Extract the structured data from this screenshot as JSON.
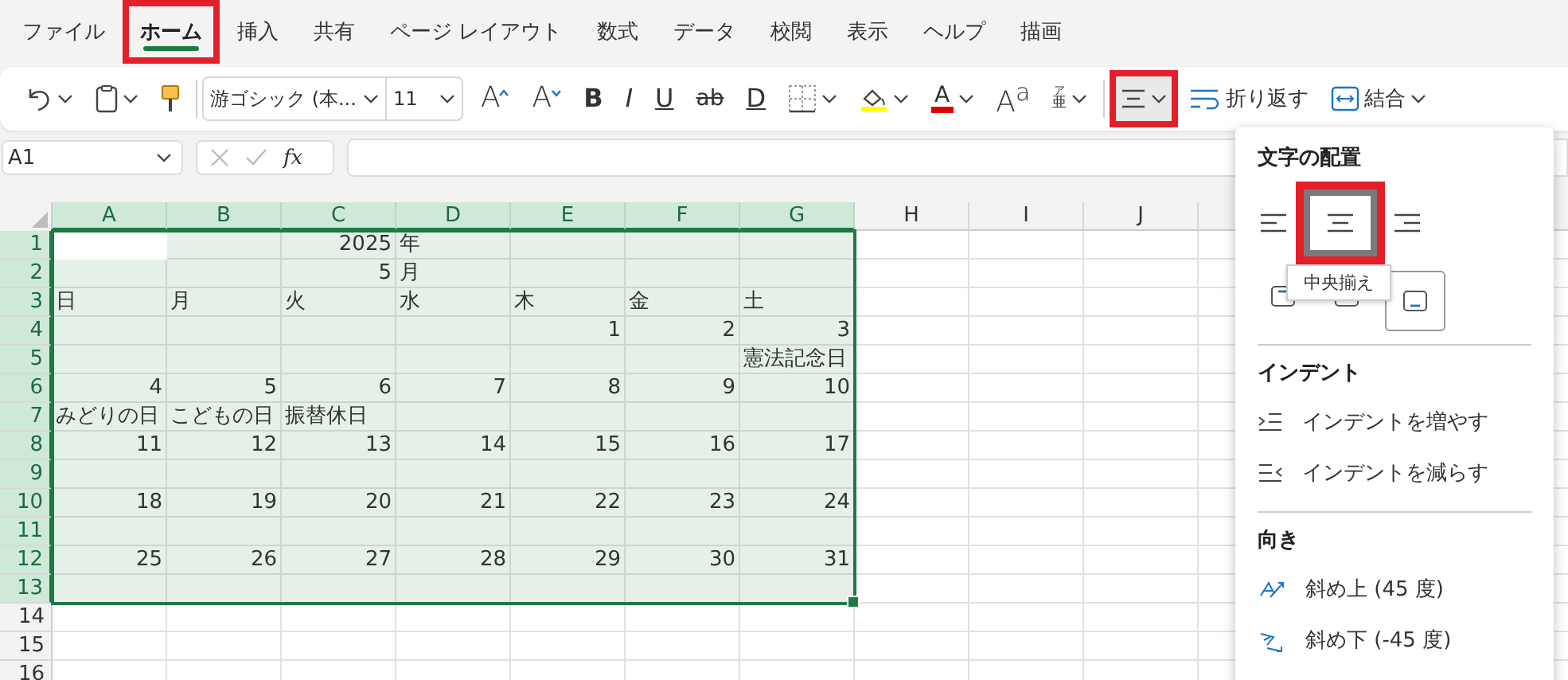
{
  "ribbon_tabs": [
    {
      "label": "ファイル",
      "selected": false,
      "highlighted": false
    },
    {
      "label": "ホーム",
      "selected": true,
      "highlighted": true
    },
    {
      "label": "挿入",
      "selected": false,
      "highlighted": false
    },
    {
      "label": "共有",
      "selected": false,
      "highlighted": false
    },
    {
      "label": "ページ レイアウト",
      "selected": false,
      "highlighted": false
    },
    {
      "label": "数式",
      "selected": false,
      "highlighted": false
    },
    {
      "label": "データ",
      "selected": false,
      "highlighted": false
    },
    {
      "label": "校閲",
      "selected": false,
      "highlighted": false
    },
    {
      "label": "表示",
      "selected": false,
      "highlighted": false
    },
    {
      "label": "ヘルプ",
      "selected": false,
      "highlighted": false
    },
    {
      "label": "描画",
      "selected": false,
      "highlighted": false
    }
  ],
  "toolbar": [
    {
      "kind": "undo",
      "caret": true
    },
    {
      "kind": "paste",
      "caret": true
    },
    {
      "kind": "format-painter",
      "caret": false
    },
    {
      "kind": "separator"
    },
    {
      "kind": "font",
      "value": "游ゴシック (本...",
      "caret": true
    },
    {
      "kind": "size",
      "value": "11",
      "caret": true
    },
    {
      "kind": "grow",
      "text": "A",
      "caret": false
    },
    {
      "kind": "shrink",
      "text": "A",
      "caret": false
    },
    {
      "kind": "bold",
      "text": "B",
      "caret": false
    },
    {
      "kind": "italic",
      "text": "I",
      "caret": false
    },
    {
      "kind": "underline",
      "text": "U",
      "caret": false
    },
    {
      "kind": "strike",
      "text": "ab",
      "caret": false
    },
    {
      "kind": "double-underline",
      "text": "D",
      "caret": false
    },
    {
      "kind": "borders",
      "caret": true
    },
    {
      "kind": "fill-color",
      "caret": true
    },
    {
      "kind": "font-color",
      "text": "A",
      "caret": true
    },
    {
      "kind": "superscript",
      "text": "A$^{a}$",
      "caret": false
    },
    {
      "kind": "phonetic",
      "ruby": "ア",
      "text": "亜",
      "caret": true
    },
    {
      "kind": "separator"
    },
    {
      "kind": "align",
      "caret": true,
      "pressed": true,
      "highlighted": true
    },
    {
      "kind": "wrap",
      "text": "折り返す",
      "caret": false
    },
    {
      "kind": "merge",
      "text": "結合",
      "caret": true
    }
  ],
  "formula_bar": {
    "name_box": "A1",
    "fx": "fx"
  },
  "sheet": {
    "columns": [
      {
        "label": "A",
        "selected": true
      },
      {
        "label": "B",
        "selected": true
      },
      {
        "label": "C",
        "selected": true
      },
      {
        "label": "D",
        "selected": true
      },
      {
        "label": "E",
        "selected": true
      },
      {
        "label": "F",
        "selected": true
      },
      {
        "label": "G",
        "selected": true
      },
      {
        "label": "H",
        "selected": false
      },
      {
        "label": "I",
        "selected": false
      },
      {
        "label": "J",
        "selected": false
      }
    ],
    "rows": [
      {
        "label": "1",
        "selected": true,
        "active": true,
        "kind": "title",
        "cells": [
          "",
          "",
          "2025",
          "年",
          "",
          "",
          ""
        ]
      },
      {
        "label": "2",
        "selected": true,
        "active": false,
        "kind": "title",
        "cells": [
          "",
          "",
          "5",
          "月",
          "",
          "",
          ""
        ]
      },
      {
        "label": "3",
        "selected": true,
        "active": false,
        "kind": "labels",
        "cells": [
          "日",
          "月",
          "火",
          "水",
          "木",
          "金",
          "土"
        ]
      },
      {
        "label": "4",
        "selected": true,
        "active": false,
        "kind": "dates",
        "cells": [
          "",
          "",
          "",
          "",
          "1",
          "2",
          "3"
        ]
      },
      {
        "label": "5",
        "selected": true,
        "active": false,
        "kind": "labels",
        "cells": [
          "",
          "",
          "",
          "",
          "",
          "",
          "憲法記念日"
        ]
      },
      {
        "label": "6",
        "selected": true,
        "active": false,
        "kind": "dates",
        "cells": [
          "4",
          "5",
          "6",
          "7",
          "8",
          "9",
          "10"
        ]
      },
      {
        "label": "7",
        "selected": true,
        "active": false,
        "kind": "labels",
        "cells": [
          "みどりの日",
          "こどもの日",
          "振替休日",
          "",
          "",
          "",
          ""
        ]
      },
      {
        "label": "8",
        "selected": true,
        "active": false,
        "kind": "dates",
        "cells": [
          "11",
          "12",
          "13",
          "14",
          "15",
          "16",
          "17"
        ]
      },
      {
        "label": "9",
        "selected": true,
        "active": false,
        "kind": "labels",
        "cells": []
      },
      {
        "label": "10",
        "selected": true,
        "active": false,
        "kind": "dates",
        "cells": [
          "18",
          "19",
          "20",
          "21",
          "22",
          "23",
          "24"
        ]
      },
      {
        "label": "11",
        "selected": true,
        "active": false,
        "kind": "labels",
        "cells": []
      },
      {
        "label": "12",
        "selected": true,
        "active": false,
        "kind": "dates",
        "cells": [
          "25",
          "26",
          "27",
          "28",
          "29",
          "30",
          "31"
        ]
      },
      {
        "label": "13",
        "selected": true,
        "active": false,
        "kind": "labels",
        "cells": []
      },
      {
        "label": "14",
        "selected": false,
        "active": false,
        "kind": "labels",
        "cells": []
      },
      {
        "label": "15",
        "selected": false,
        "active": false,
        "kind": "labels",
        "cells": []
      },
      {
        "label": "16",
        "selected": false,
        "active": false,
        "kind": "labels",
        "cells": []
      }
    ]
  },
  "alignment_panel": {
    "title": "文字の配置",
    "horizontal": [
      {
        "kind": "left",
        "selected": false,
        "highlighted": false
      },
      {
        "kind": "center",
        "selected": true,
        "highlighted": true
      },
      {
        "kind": "right",
        "selected": false,
        "highlighted": false
      }
    ],
    "tooltip": "中央揃え",
    "vertical": [
      {
        "kind": "top",
        "selected": false
      },
      {
        "kind": "middle",
        "selected": false
      },
      {
        "kind": "bottom",
        "selected": true
      }
    ],
    "sections": [
      {
        "title": "インデント",
        "items": [
          {
            "kind": "indent-increase",
            "label": "インデントを増やす"
          },
          {
            "kind": "indent-decrease",
            "label": "インデントを減らす"
          }
        ]
      },
      {
        "title": "向き",
        "items": [
          {
            "kind": "rotate-up",
            "label": "斜め上 (45 度)"
          },
          {
            "kind": "rotate-down",
            "label": "斜め下 (-45 度)"
          }
        ]
      }
    ]
  }
}
